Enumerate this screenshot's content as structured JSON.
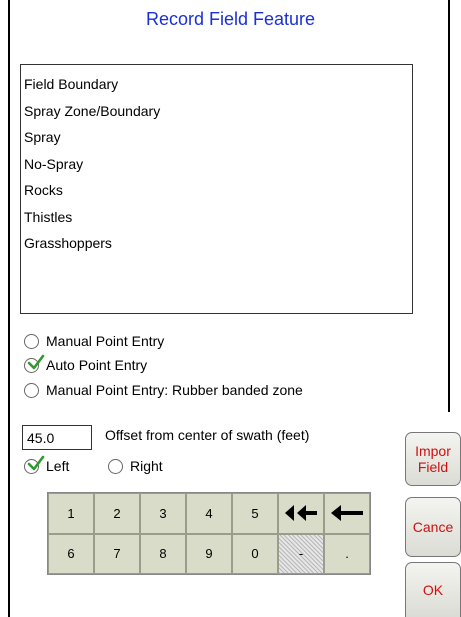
{
  "title": "Record Field Feature",
  "features": [
    "Field Boundary",
    "Spray Zone/Boundary",
    "Spray",
    "No-Spray",
    "Rocks",
    "Thistles",
    "Grasshoppers"
  ],
  "entry_modes": {
    "manual": "Manual Point Entry",
    "auto": "Auto Point Entry",
    "rubber": "Manual Point Entry: Rubber banded zone",
    "selected": "auto"
  },
  "offset": {
    "value": "45.0",
    "label": "Offset from center of swath (feet)"
  },
  "side": {
    "left": "Left",
    "right": "Right",
    "selected": "left"
  },
  "keypad": {
    "row1": [
      "1",
      "2",
      "3",
      "4",
      "5"
    ],
    "row2": [
      "6",
      "7",
      "8",
      "9",
      "0"
    ],
    "dash": "-",
    "dot": ".",
    "clear_all_glyph": "⯬⯬",
    "backspace_glyph": "⟵"
  },
  "buttons": {
    "import_line1": "Impor",
    "import_line2": "Field",
    "cancel": "Cance",
    "ok": "OK"
  },
  "colors": {
    "title": "#1a2fd8",
    "button_text": "#cc1111",
    "check": "#2e9a2e",
    "keypad_bg": "#d9dcc8"
  }
}
